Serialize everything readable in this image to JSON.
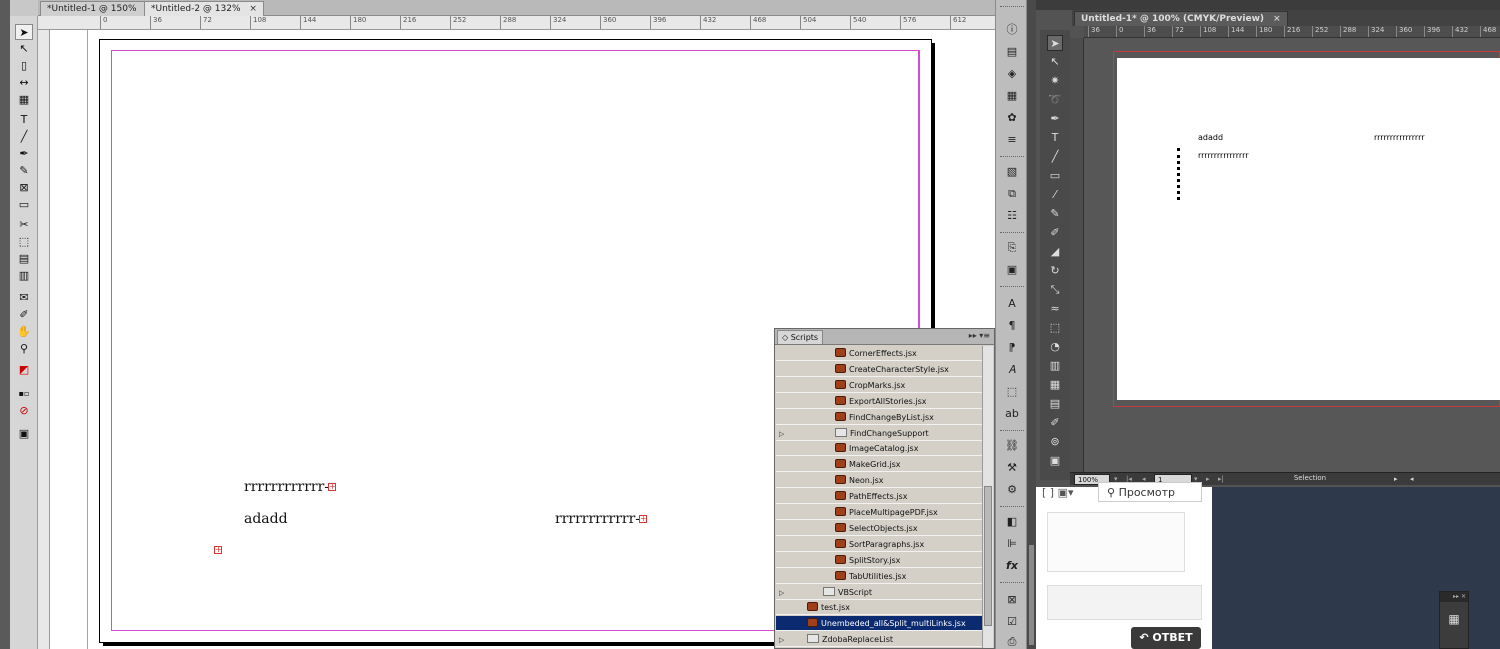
{
  "left_window": {
    "tabs": [
      {
        "label": "*Untitled-1 @ 150%"
      },
      {
        "label": "*Untitled-2 @ 132%"
      }
    ],
    "tab_close": "×",
    "ruler_ticks": [
      "0",
      "36",
      "72",
      "108",
      "144",
      "180",
      "216",
      "252",
      "288",
      "324",
      "360",
      "396",
      "432",
      "468",
      "504",
      "540",
      "576",
      "612"
    ],
    "tools": [
      "selection-tool",
      "direct-selection-tool",
      "page-tool",
      "gap-tool",
      "content-collector-tool",
      "type-tool",
      "line-tool",
      "pen-tool",
      "pencil-tool",
      "rectangle-frame-tool",
      "rectangle-tool",
      "scissors-tool",
      "free-transform-tool",
      "gradient-swatch-tool",
      "gradient-feather-tool",
      "note-tool",
      "eyedropper-tool",
      "hand-tool",
      "zoom-tool",
      "fill-stroke",
      "swap",
      "apply-none",
      "screen-mode"
    ],
    "document_text": {
      "line1": "rrrrrrrrrrrr-",
      "line2": "adadd",
      "line3": "rrrrrrrrrrrr-"
    }
  },
  "panel_strip_icons": [
    "info-icon",
    "pages-icon",
    "layers-icon",
    "links-icon",
    "swatches-icon",
    "stroke-icon",
    "text-wrap-icon",
    "align-icon",
    "table-icon",
    "hyperlinks-icon",
    "effects-icon",
    "character-icon",
    "paragraph-icon",
    "paragraph-styles-icon",
    "character-styles-icon",
    "glyphs-icon",
    "chain-icon",
    "scripts-icon",
    "gear-icon",
    "layers-2-icon",
    "align-2-icon",
    "fx-icon",
    "pathfinder-icon",
    "checkbox-icon",
    "export-icon"
  ],
  "scripts_panel": {
    "title": "Scripts",
    "items": [
      {
        "label": "CornerEffects.jsx",
        "type": "script",
        "indent": 3,
        "selected": false
      },
      {
        "label": "CreateCharacterStyle.jsx",
        "type": "script",
        "indent": 3,
        "selected": false
      },
      {
        "label": "CropMarks.jsx",
        "type": "script",
        "indent": 3,
        "selected": false
      },
      {
        "label": "ExportAllStories.jsx",
        "type": "script",
        "indent": 3,
        "selected": false
      },
      {
        "label": "FindChangeByList.jsx",
        "type": "script",
        "indent": 3,
        "selected": false
      },
      {
        "label": "FindChangeSupport",
        "type": "folder",
        "indent": 3,
        "selected": false
      },
      {
        "label": "ImageCatalog.jsx",
        "type": "script",
        "indent": 3,
        "selected": false
      },
      {
        "label": "MakeGrid.jsx",
        "type": "script",
        "indent": 3,
        "selected": false
      },
      {
        "label": "Neon.jsx",
        "type": "script",
        "indent": 3,
        "selected": false
      },
      {
        "label": "PathEffects.jsx",
        "type": "script",
        "indent": 3,
        "selected": false
      },
      {
        "label": "PlaceMultipagePDF.jsx",
        "type": "script",
        "indent": 3,
        "selected": false
      },
      {
        "label": "SelectObjects.jsx",
        "type": "script",
        "indent": 3,
        "selected": false
      },
      {
        "label": "SortParagraphs.jsx",
        "type": "script",
        "indent": 3,
        "selected": false
      },
      {
        "label": "SplitStory.jsx",
        "type": "script",
        "indent": 3,
        "selected": false
      },
      {
        "label": "TabUtilities.jsx",
        "type": "script",
        "indent": 3,
        "selected": false
      },
      {
        "label": "VBScript",
        "type": "folder",
        "indent": 2,
        "selected": false
      },
      {
        "label": "test.jsx",
        "type": "script",
        "indent": 1,
        "selected": false
      },
      {
        "label": "Unembeded_all&Split_multiLinks.jsx",
        "type": "script",
        "indent": 1,
        "selected": true
      },
      {
        "label": "ZdobaReplaceList",
        "type": "folder",
        "indent": 1,
        "selected": false
      }
    ]
  },
  "right_window": {
    "tab_label": "Untitled-1* @ 100% (CMYK/Preview)",
    "tab_close": "×",
    "ruler_ticks": [
      "36",
      "0",
      "36",
      "72",
      "108",
      "144",
      "180",
      "216",
      "252",
      "288",
      "324",
      "360",
      "396",
      "432",
      "468"
    ],
    "document_text": {
      "line1": "adadd",
      "line2": "rrrrrrrrrrrrrrrr",
      "line3": "rrrrrrrrrrrrrrrr"
    },
    "status": {
      "zoom": "100%",
      "page": "1",
      "mode": "Selection"
    }
  },
  "web": {
    "preview_label": "Просмотр",
    "answer_label": "ОТВЕТ"
  },
  "colors": {
    "margin_guide": "#d54ad5",
    "selected_row": "#0b2a6f",
    "overset": "#dd3333"
  }
}
